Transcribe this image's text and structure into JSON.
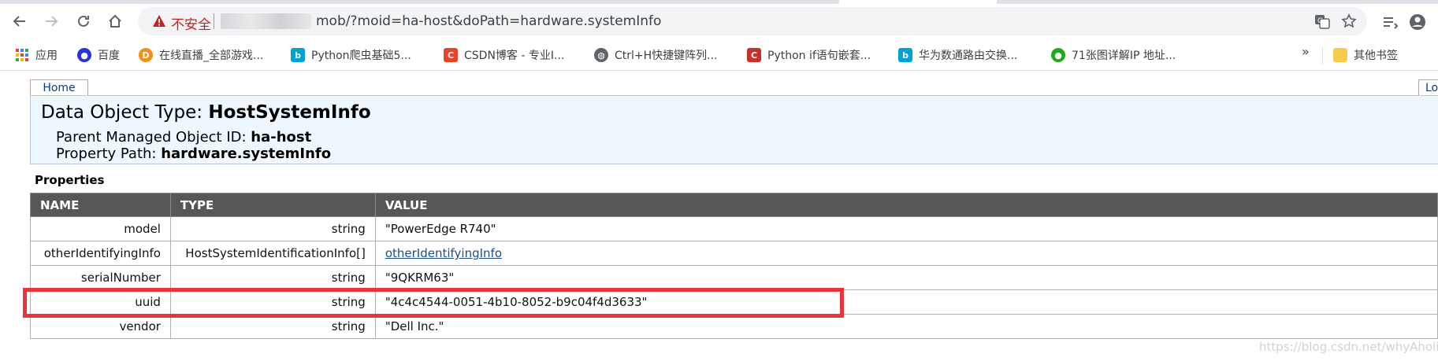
{
  "browser": {
    "security_label": "不安全",
    "url": "mob/?moid=ha-host&doPath=hardware.systemInfo",
    "bookmarks": [
      {
        "label": "应用",
        "icon": "apps-grid-icon",
        "color": "#4285f4"
      },
      {
        "label": "百度",
        "icon": "baidu-paw-icon",
        "color": "#2932e1"
      },
      {
        "label": "在线直播_全部游戏...",
        "icon": "douyu-fish-icon",
        "color": "#f29113"
      },
      {
        "label": "Python爬虫基础5...",
        "icon": "bilibili-tv-icon",
        "color": "#00a1d6"
      },
      {
        "label": "CSDN博客 - 专业I...",
        "icon": "csdn-c-icon",
        "color": "#e9442a"
      },
      {
        "label": "Ctrl+H快捷键阵列...",
        "icon": "globe-icon",
        "color": "#5f6368"
      },
      {
        "label": "Python if语句嵌套...",
        "icon": "csdn-c-icon",
        "color": "#c9302c"
      },
      {
        "label": "华为数通路由交换...",
        "icon": "bilibili-tv-icon",
        "color": "#00a1d6"
      },
      {
        "label": "71张图详解IP 地址...",
        "icon": "wechat-icon",
        "color": "#1aad19"
      }
    ],
    "more_glyph": "»",
    "other_bookmarks": "其他书签"
  },
  "page": {
    "home_tab": "Home",
    "logout_tab": "Lo",
    "dot_label": "Data Object Type: ",
    "dot_value": "HostSystemInfo",
    "parent_label": "Parent Managed Object ID: ",
    "parent_value": "ha-host",
    "path_label": "Property Path: ",
    "path_value": "hardware.systemInfo",
    "properties_heading": "Properties",
    "columns": [
      "NAME",
      "TYPE",
      "VALUE"
    ],
    "rows": [
      {
        "name": "model",
        "type": "string",
        "value": "\"PowerEdge R740\"",
        "link": false
      },
      {
        "name": "otherIdentifyingInfo",
        "type": "HostSystemIdentificationInfo[]",
        "value": "otherIdentifyingInfo",
        "link": true
      },
      {
        "name": "serialNumber",
        "type": "string",
        "value": "\"9QKRM63\"",
        "link": false
      },
      {
        "name": "uuid",
        "type": "string",
        "value": "\"4c4c4544-0051-4b10-8052-b9c04f4d3633\"",
        "link": false
      },
      {
        "name": "vendor",
        "type": "string",
        "value": "\"Dell Inc.\"",
        "link": false
      }
    ],
    "highlight_color": "#e8343a",
    "watermark": "https://blog.csdn.net/whyAholic"
  }
}
